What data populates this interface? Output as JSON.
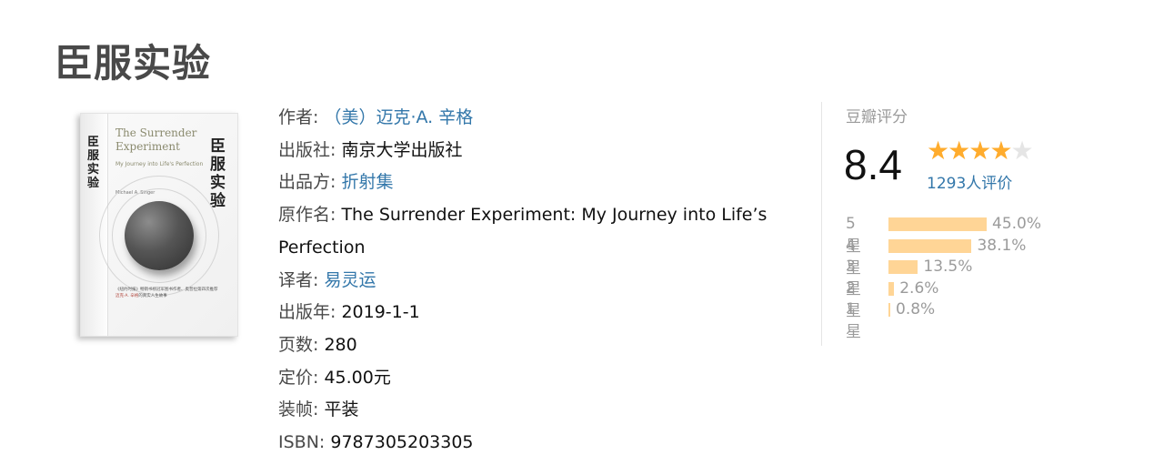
{
  "title": "臣服实验",
  "cover": {
    "spine_title": "臣服实验",
    "en_title_line1": "The Surrender",
    "en_title_line2": "Experiment",
    "en_subtitle": "My Journey into Life's Perfection",
    "cn_title": "臣服实验",
    "author_line": "Michael A. Singer",
    "blurb_line1": "《纽约时报》畅销书榜冠军图书作者、奥普拉第四次推荐",
    "blurb_line2_red": "迈克·A. 辛格",
    "blurb_line2": "的真实人生故事"
  },
  "info": {
    "author_label": "作者:",
    "author_value": "（美）迈克·A. 辛格",
    "publisher_label": "出版社:",
    "publisher_value": "南京大学出版社",
    "producer_label": "出品方:",
    "producer_value": "折射集",
    "original_title_label": "原作名:",
    "original_title_value": "The Surrender Experiment: My Journey into Life’s Perfection",
    "translator_label": "译者:",
    "translator_value": "易灵运",
    "pub_year_label": "出版年:",
    "pub_year_value": "2019-1-1",
    "pages_label": "页数:",
    "pages_value": "280",
    "price_label": "定价:",
    "price_value": "45.00元",
    "binding_label": "装帧:",
    "binding_value": "平装",
    "isbn_label": "ISBN:",
    "isbn_value": "9787305203305"
  },
  "rating": {
    "label": "豆瓣评分",
    "score": "8.4",
    "stars_filled": 4,
    "stars_total": 5,
    "count_text": "1293人评价",
    "distribution": [
      {
        "label": "5星",
        "percent_text": "45.0%",
        "percent": 45.0
      },
      {
        "label": "4星",
        "percent_text": "38.1%",
        "percent": 38.1
      },
      {
        "label": "3星",
        "percent_text": "13.5%",
        "percent": 13.5
      },
      {
        "label": "2星",
        "percent_text": "2.6%",
        "percent": 2.6
      },
      {
        "label": "1星",
        "percent_text": "0.8%",
        "percent": 0.8
      }
    ],
    "colors": {
      "star_on": "#ffac2d",
      "star_off": "#e5e5e5",
      "bar": "#ffd596",
      "link": "#3377aa"
    }
  }
}
